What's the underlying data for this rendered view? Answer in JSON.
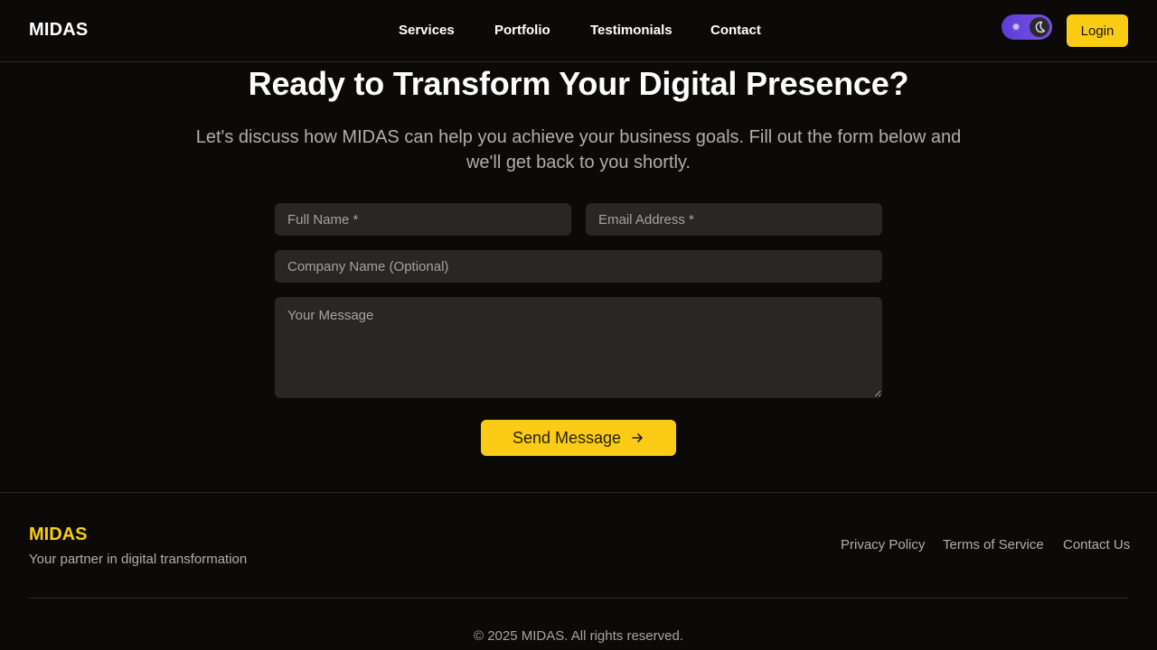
{
  "header": {
    "brand": "MIDAS",
    "nav": [
      "Services",
      "Portfolio",
      "Testimonials",
      "Contact"
    ],
    "theme_toggle": {
      "state": "dark",
      "light_icon": "sun-icon",
      "dark_icon": "moon-icon"
    },
    "login_label": "Login"
  },
  "hero": {
    "title": "Ready to Transform Your Digital Presence?",
    "subtitle": "Let's discuss how MIDAS can help you achieve your business goals. Fill out the form below and we'll get back to you shortly."
  },
  "form": {
    "full_name": {
      "placeholder": "Full Name *",
      "value": ""
    },
    "email": {
      "placeholder": "Email Address *",
      "value": ""
    },
    "company": {
      "placeholder": "Company Name (Optional)",
      "value": ""
    },
    "message": {
      "placeholder": "Your Message",
      "value": ""
    },
    "submit_label": "Send Message",
    "submit_icon": "arrow-right-icon"
  },
  "footer": {
    "brand": "MIDAS",
    "tagline": "Your partner in digital transformation",
    "links": [
      "Privacy Policy",
      "Terms of Service",
      "Contact Us"
    ],
    "copyright": "© 2025 MIDAS. All rights reserved."
  },
  "colors": {
    "background": "#0b0a09",
    "accent": "#facc15",
    "input_bg": "#292624",
    "muted_text": "#b3aea7",
    "toggle": "#6a46df"
  }
}
